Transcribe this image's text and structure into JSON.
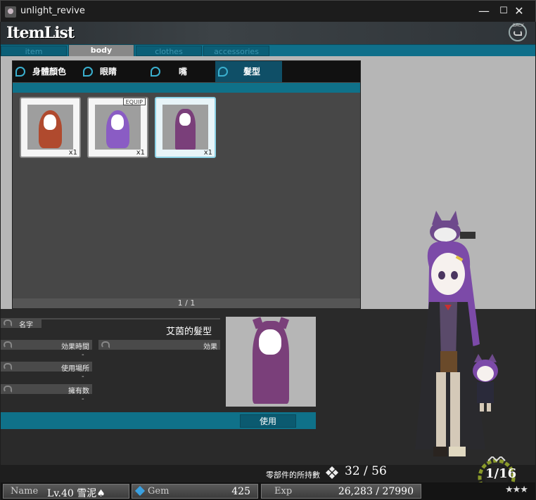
{
  "window": {
    "title": "unlight_revive",
    "minimize": "—",
    "maximize": "☐",
    "close": "✕"
  },
  "header": {
    "logo": "ItemList",
    "back_label": "BACK"
  },
  "tabs": [
    {
      "label": "item",
      "active": false
    },
    {
      "label": "body",
      "active": true
    },
    {
      "label": "clothes",
      "active": false
    },
    {
      "label": "accessories",
      "active": false
    }
  ],
  "subtabs": [
    {
      "label": "身體顏色",
      "active": false
    },
    {
      "label": "眼睛",
      "active": false
    },
    {
      "label": "嘴",
      "active": false
    },
    {
      "label": "髮型",
      "active": true
    }
  ],
  "items": [
    {
      "count": "x1",
      "hair_color": "#b04a2e",
      "equipped": false,
      "selected": false
    },
    {
      "count": "x1",
      "hair_color": "#8a5cc4",
      "equipped": true,
      "equip_label": "EQUIP",
      "selected": false
    },
    {
      "count": "x1",
      "hair_color": "#7a3f7a",
      "equipped": false,
      "selected": true
    }
  ],
  "pager": "1 / 1",
  "info": {
    "name_label": "名字",
    "item_name": "艾茵的髮型",
    "duration_label": "効果時間",
    "duration_value": "-",
    "effect_label": "効果",
    "location_label": "使用場所",
    "location_value": "-",
    "owned_label": "擁有数",
    "owned_value": "-",
    "use_button": "使用"
  },
  "parts": {
    "label": "零部件的所持數",
    "count": "32 / 56"
  },
  "status": {
    "name_key": "Name",
    "name_value": "Lv.40 雪泥♠",
    "gem_key": "Gem",
    "gem_value": "425",
    "exp_key": "Exp",
    "exp_value": "26,283 / 27990"
  },
  "rank": {
    "text": "1/16",
    "stars": "★★★"
  },
  "colors": {
    "accent": "#0f7189",
    "panel": "#474747",
    "stage": "#b6b6b6"
  }
}
